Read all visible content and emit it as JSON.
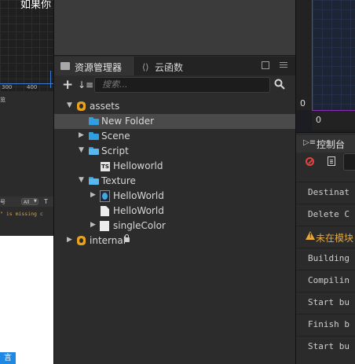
{
  "left_panel": {
    "title_fragment": "如果你",
    "axis_ticks": [
      "300",
      "400"
    ],
    "console_tab_fragment": "览",
    "filter_label_fragment": "号",
    "filter_value": "All",
    "toggle_fragment": "T",
    "log_fragment": "\" is missing c",
    "button_fragment": "言"
  },
  "assets_panel": {
    "tabs": [
      {
        "label": "资源管理器"
      },
      {
        "label": "云函数"
      }
    ],
    "search_placeholder": "搜索...",
    "tree": [
      {
        "label": "assets"
      },
      {
        "label": "New Folder"
      },
      {
        "label": "Scene"
      },
      {
        "label": "Script"
      },
      {
        "label": "Helloworld"
      },
      {
        "label": "Texture"
      },
      {
        "label": "HelloWorld"
      },
      {
        "label": "HelloWorld"
      },
      {
        "label": "singleColor"
      },
      {
        "label": "internal"
      }
    ],
    "ts_badge": "TS"
  },
  "right_panel": {
    "axis_y_zero": "0",
    "axis_x_zero": "0",
    "console_title": "控制台",
    "logs": [
      {
        "text": "Destinat"
      },
      {
        "text": "Delete C"
      },
      {
        "text": "未在模块"
      },
      {
        "text": "Building"
      },
      {
        "text": "Compilin"
      },
      {
        "text": "Start bu"
      },
      {
        "text": "Finish b"
      },
      {
        "text": "Start bu"
      }
    ]
  },
  "colors": {
    "selection": "#4a4a4a",
    "folder": "#2f9fe0",
    "db": "#e8a21d",
    "warning": "#e7a83a",
    "game_view_border": "#8c2bb5"
  }
}
